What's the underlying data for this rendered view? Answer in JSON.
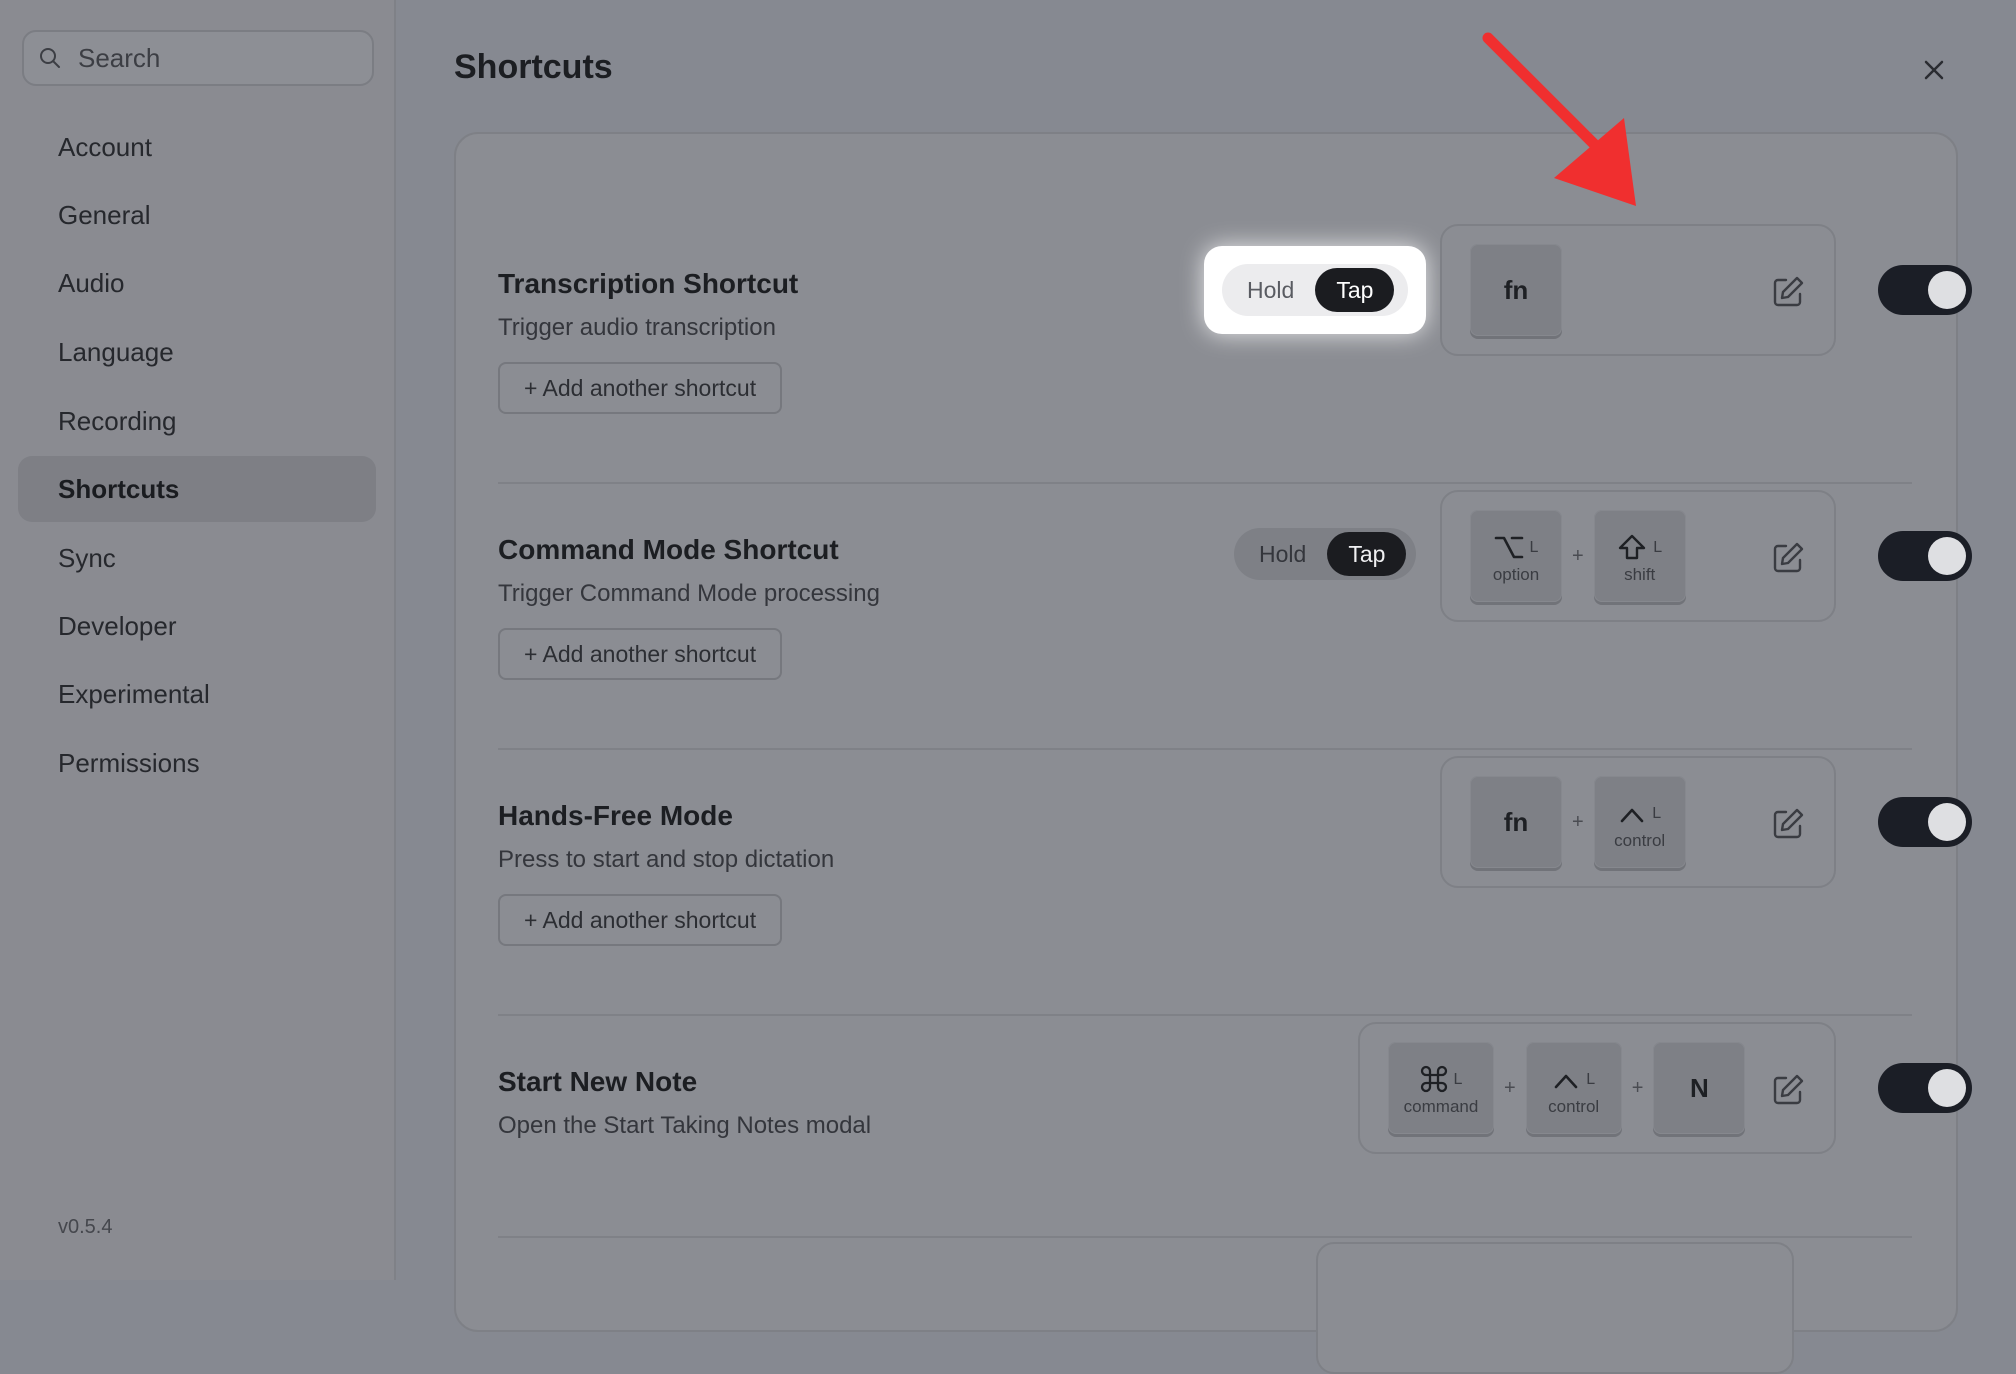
{
  "sidebar": {
    "search_placeholder": "Search",
    "items": [
      {
        "label": "Account"
      },
      {
        "label": "General"
      },
      {
        "label": "Audio"
      },
      {
        "label": "Language"
      },
      {
        "label": "Recording"
      },
      {
        "label": "Shortcuts",
        "active": true
      },
      {
        "label": "Sync"
      },
      {
        "label": "Developer"
      },
      {
        "label": "Experimental"
      },
      {
        "label": "Permissions"
      }
    ],
    "version": "v0.5.4"
  },
  "main": {
    "title": "Shortcuts",
    "rows": [
      {
        "title": "Transcription Shortcut",
        "description": "Trigger audio transcription",
        "add_label": "+ Add another shortcut",
        "mode": {
          "hold": "Hold",
          "tap": "Tap",
          "selected": "Tap"
        },
        "keys": [
          {
            "main": "fn"
          }
        ],
        "enabled": true
      },
      {
        "title": "Command Mode Shortcut",
        "description": "Trigger Command Mode processing",
        "add_label": "+ Add another shortcut",
        "mode": {
          "hold": "Hold",
          "tap": "Tap",
          "selected": "Tap"
        },
        "keys": [
          {
            "symbol": "option-icon",
            "side": "L",
            "name": "option"
          },
          {
            "symbol": "shift-icon",
            "side": "L",
            "name": "shift"
          }
        ],
        "plus": "+",
        "enabled": true
      },
      {
        "title": "Hands-Free Mode",
        "description": "Press to start and stop dictation",
        "add_label": "+ Add another shortcut",
        "keys": [
          {
            "main": "fn"
          },
          {
            "symbol": "control-icon",
            "side": "L",
            "name": "control"
          }
        ],
        "plus": "+",
        "enabled": true
      },
      {
        "title": "Start New Note",
        "description": "Open the Start Taking Notes modal",
        "keys": [
          {
            "symbol": "command-icon",
            "side": "L",
            "name": "command"
          },
          {
            "symbol": "control-icon",
            "side": "L",
            "name": "control"
          },
          {
            "main": "N"
          }
        ],
        "plus": "+",
        "enabled": true
      }
    ]
  },
  "colors": {
    "accent_dark": "#1b1c20",
    "annotation_arrow": "#f02f2f"
  }
}
